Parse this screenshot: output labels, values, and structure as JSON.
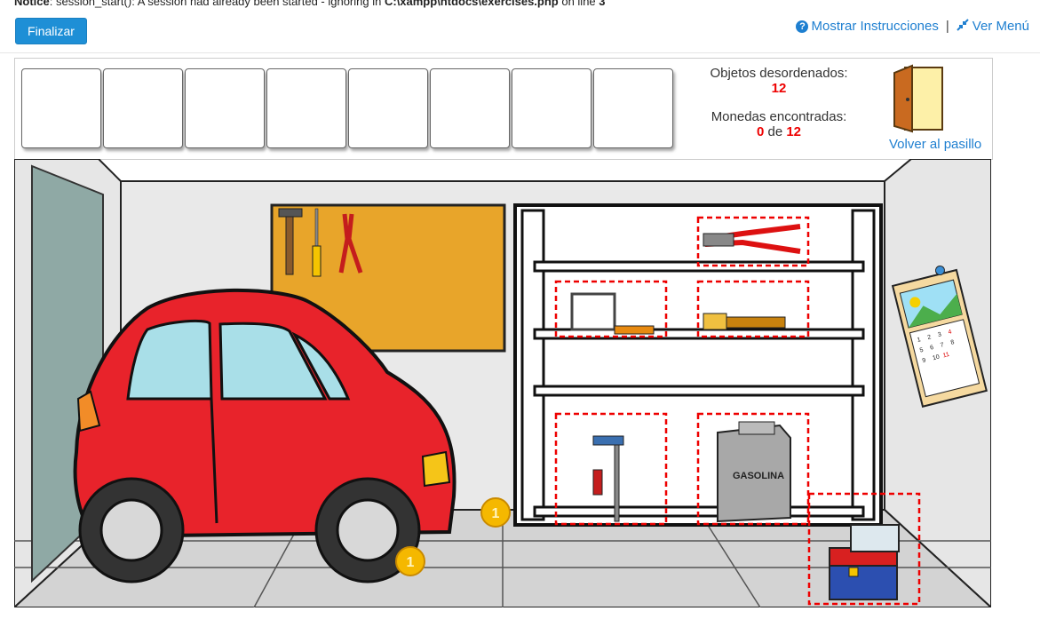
{
  "notice": {
    "label": "Notice",
    "message": ": session_start(): A session had already been started - ignoring in ",
    "file": "C:\\xampp\\htdocs\\exercises.php",
    "line_text": " on line ",
    "line": "3"
  },
  "toolbar": {
    "finish_label": "Finalizar",
    "instructions_label": "Mostrar Instrucciones",
    "separator": "|",
    "menu_label": "Ver Menú"
  },
  "inventory": {
    "slots": [
      "",
      "",
      "",
      "",
      "",
      "",
      "",
      ""
    ]
  },
  "stats": {
    "objects_label": "Objetos desordenados:",
    "objects_count": "12",
    "coins_label": "Monedas encontradas:",
    "coins_found": "0",
    "coins_of": "de",
    "coins_total": "12"
  },
  "navigation": {
    "back_label": "Volver al pasillo"
  },
  "scene": {
    "fuel_can_text": "GASOLINA",
    "coin_text": "1",
    "calendar_numbers": [
      "1",
      "2",
      "3",
      "4",
      "5",
      "6",
      "7",
      "8",
      "9",
      "10",
      "11"
    ]
  },
  "colors": {
    "accent": "#1e8fd6",
    "link": "#1e7fd0",
    "counter_red": "#e00000",
    "car_red": "#e8232b",
    "board": "#e8a52a",
    "highlight_dash": "#e00000"
  }
}
